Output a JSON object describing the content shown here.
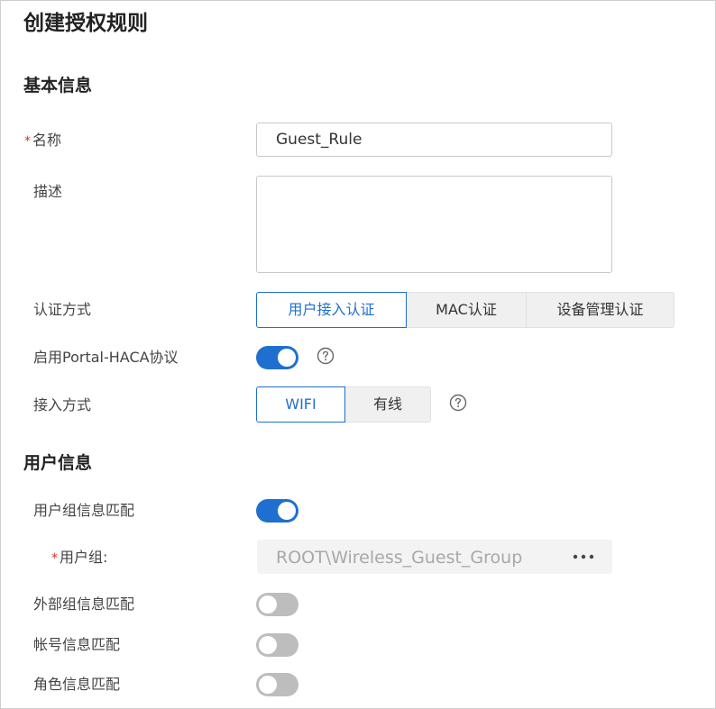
{
  "page": {
    "title": "创建授权规则"
  },
  "basic_info": {
    "section_title": "基本信息",
    "name_label": "名称",
    "name_value": "Guest_Rule",
    "desc_label": "描述",
    "desc_value": "",
    "auth_method_label": "认证方式",
    "auth_methods": [
      {
        "label": "用户接入认证",
        "selected": true
      },
      {
        "label": "MAC认证",
        "selected": false
      },
      {
        "label": "设备管理认证",
        "selected": false
      }
    ],
    "portal_haca_label": "启用Portal-HACA协议",
    "portal_haca_enabled": true,
    "access_mode_label": "接入方式",
    "access_modes": [
      {
        "label": "WIFI",
        "selected": true
      },
      {
        "label": "有线",
        "selected": false
      }
    ]
  },
  "user_info": {
    "section_title": "用户信息",
    "group_match_label": "用户组信息匹配",
    "group_match_enabled": true,
    "group_label": "用户组:",
    "group_value": "ROOT\\Wireless_Guest_Group",
    "external_group_label": "外部组信息匹配",
    "external_group_enabled": false,
    "account_match_label": "帐号信息匹配",
    "account_match_enabled": false,
    "role_match_label": "角色信息匹配",
    "role_match_enabled": false
  },
  "colors": {
    "accent": "#1f6fd0",
    "required": "#e0312e",
    "toggle_off": "#bdbdbd"
  },
  "icons": {
    "help": "question-circle-icon",
    "more": "more-dots-icon"
  }
}
